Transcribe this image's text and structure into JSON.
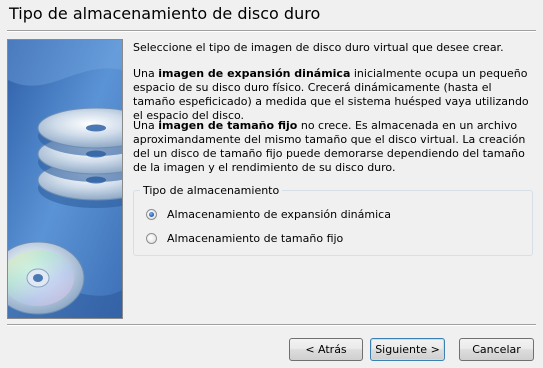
{
  "header": {
    "title": "Tipo de almacenamiento de disco duro"
  },
  "content": {
    "intro": "Seleccione el tipo de imagen de disco duro virtual que desee crear.",
    "dynamic": {
      "prefix": "Una ",
      "bold": "imagen de expansión dinámica",
      "rest": " inicialmente ocupa un pequeño espacio de su disco duro físico. Crecerá dinámicamente (hasta el tamaño espeficicado) a medida que el sistema huésped vaya utilizando el espacio del disco."
    },
    "fixed": {
      "prefix": "Una ",
      "bold": "imagen de tamaño fijo",
      "rest": " no crece. Es almacenada en un archivo aproximandamente del mismo tamaño que el disco virtual. La creación del un disco de tamaño fijo puede demorarse dependiendo del tamaño de la imagen y el rendimiento de su disco duro."
    }
  },
  "storage_group": {
    "legend": "Tipo de almacenamiento",
    "options": [
      {
        "label": "Almacenamiento de expansión dinámica",
        "selected": true
      },
      {
        "label": "Almacenamiento de tamaño fijo",
        "selected": false
      }
    ]
  },
  "buttons": {
    "back": "< Atrás",
    "next": "Siguiente >",
    "cancel": "Cancelar"
  },
  "colors": {
    "sidebar_blue": "#4f86c9",
    "disc_silver": "#e4ecf4"
  }
}
